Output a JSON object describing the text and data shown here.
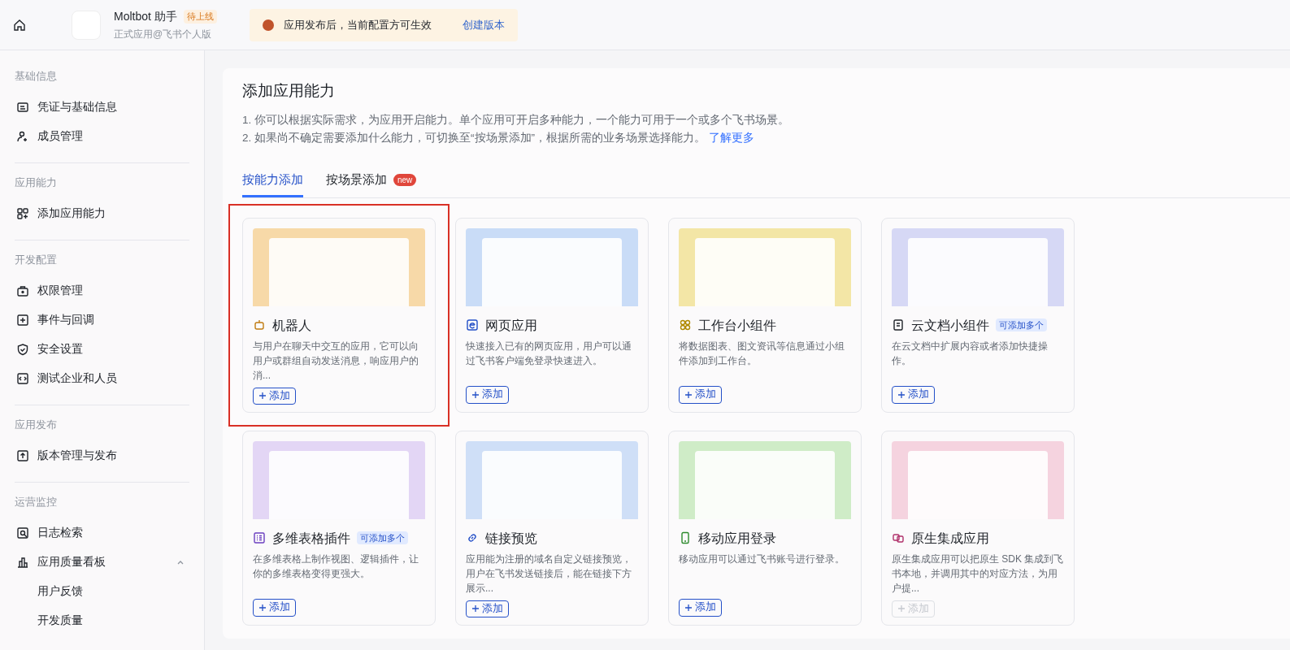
{
  "header": {
    "app_name": "Moltbot 助手",
    "status_badge": "待上线",
    "app_type": "正式应用@飞书个人版",
    "notice": "应用发布后，当前配置方可生效",
    "notice_link": "创建版本"
  },
  "sidebar": {
    "sections": [
      {
        "title": "基础信息",
        "items": [
          {
            "label": "凭证与基础信息",
            "selected": false
          },
          {
            "label": "成员管理",
            "selected": false
          }
        ]
      },
      {
        "title": "应用能力",
        "items": [
          {
            "label": "添加应用能力",
            "selected": false
          }
        ]
      },
      {
        "title": "开发配置",
        "items": [
          {
            "label": "权限管理",
            "selected": false
          },
          {
            "label": "事件与回调",
            "selected": false
          },
          {
            "label": "安全设置",
            "selected": false
          },
          {
            "label": "测试企业和人员",
            "selected": false
          }
        ]
      },
      {
        "title": "应用发布",
        "items": [
          {
            "label": "版本管理与发布",
            "selected": false
          }
        ]
      },
      {
        "title": "运营监控",
        "items": [
          {
            "label": "日志检索",
            "selected": false
          },
          {
            "label": "应用质量看板",
            "selected": false,
            "expanded": true,
            "children": [
              {
                "label": "用户反馈",
                "selected": false
              },
              {
                "label": "开发质量",
                "selected": false
              }
            ]
          }
        ]
      }
    ]
  },
  "main": {
    "title": "添加应用能力",
    "notes": [
      "1. 你可以根据实际需求，为应用开启能力。单个应用可开启多种能力，一个能力可用于一个或多个飞书场景。",
      "2. 如果尚不确定需要添加什么能力，可切换至“按场景添加”，根据所需的业务场景选择能力。"
    ],
    "learn_more": "了解更多",
    "tabs": [
      {
        "label": "按能力添加",
        "selected": true
      },
      {
        "label": "按场景添加",
        "selected": false,
        "badge": "new"
      }
    ],
    "cards": [
      {
        "title": "机器人",
        "description": "与用户在聊天中交互的应用，它可以向用户或群组自动发送消息，响应用户的消...",
        "button": "添加",
        "disabled": false,
        "highlighted": true,
        "color": "#f7d9a8"
      },
      {
        "title": "网页应用",
        "description": "快速接入已有的网页应用，用户可以通过飞书客户端免登录快速进入。",
        "button": "添加",
        "disabled": false,
        "highlighted": false,
        "color": "#c9dcf7"
      },
      {
        "title": "工作台小组件",
        "description": "将数据图表、图文资讯等信息通过小组件添加到工作台。",
        "button": "添加",
        "disabled": false,
        "highlighted": false,
        "color": "#f3e6a6"
      },
      {
        "title": "云文档小组件",
        "badge": "可添加多个",
        "description": "在云文档中扩展内容或者添加快捷操作。",
        "button": "添加",
        "disabled": false,
        "highlighted": false,
        "color": "#d6d8f5"
      },
      {
        "title": "多维表格插件",
        "badge": "可添加多个",
        "description": "在多维表格上制作视图、逻辑插件，让你的多维表格变得更强大。",
        "button": "添加",
        "disabled": false,
        "highlighted": false,
        "color": "#e3d6f5"
      },
      {
        "title": "链接预览",
        "description": "应用能为注册的域名自定义链接预览，用户在飞书发送链接后，能在链接下方展示...",
        "button": "添加",
        "disabled": false,
        "highlighted": false,
        "color": "#cfdff7"
      },
      {
        "title": "移动应用登录",
        "description": "移动应用可以通过飞书账号进行登录。",
        "button": "添加",
        "disabled": false,
        "highlighted": false,
        "color": "#cfecc7"
      },
      {
        "title": "原生集成应用",
        "description": "原生集成应用可以把原生 SDK 集成到飞书本地，并调用其中的对应方法，为用户提...",
        "button": "添加",
        "disabled": true,
        "highlighted": false,
        "color": "#f5d3df"
      }
    ]
  }
}
